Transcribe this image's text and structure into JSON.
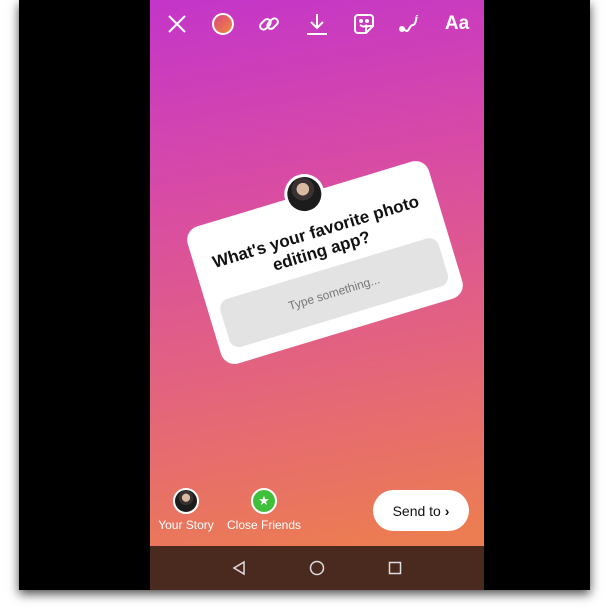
{
  "toolbar": {
    "icons": [
      "close-icon",
      "color-picker-icon",
      "link-icon",
      "download-icon",
      "sticker-icon",
      "draw-icon",
      "text-icon"
    ],
    "text_label": "Aa"
  },
  "sticker": {
    "question": "What's your favorite photo editing app?",
    "placeholder": "Type something..."
  },
  "share": {
    "your_story": "Your Story",
    "close_friends": "Close Friends",
    "send_to": "Send to"
  },
  "colors": {
    "close_friends": "#3fbf3a",
    "nav_bar": "#4a2a1f"
  }
}
